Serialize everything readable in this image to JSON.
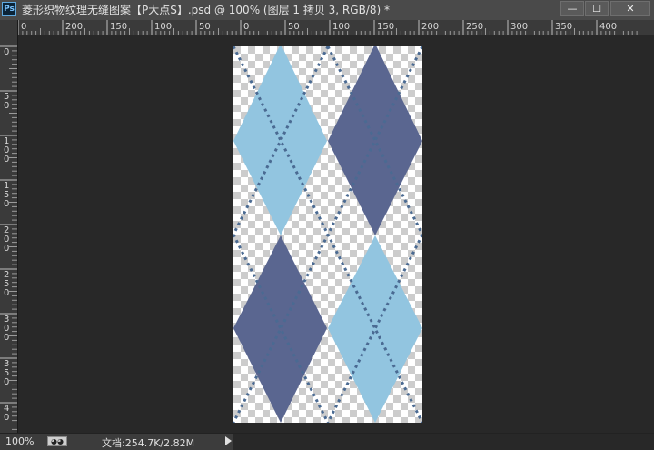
{
  "app": {
    "logo": "Ps"
  },
  "window": {
    "title": "菱形织物纹理无缝图案【P大点S】.psd @ 100% (图层 1 拷贝 3, RGB/8) *",
    "controls": {
      "minimize": "—",
      "maximize": "☐",
      "close": "✕"
    }
  },
  "ruler": {
    "h_labels": [
      "0",
      "200",
      "150",
      "100",
      "50",
      "0",
      "50",
      "100",
      "150",
      "200",
      "250",
      "300",
      "350",
      "400"
    ],
    "v_labels": [
      "0",
      "50",
      "100",
      "150",
      "200",
      "250",
      "300",
      "350",
      "40"
    ]
  },
  "canvas": {
    "pattern": "argyle",
    "colors": {
      "light_diamond": "#92c5e0",
      "dark_diamond": "#5a6690",
      "stitch": "#4a6a92",
      "checker_light": "#ffffff",
      "checker_dark": "#cccccc",
      "workspace": "#282828"
    }
  },
  "status": {
    "zoom": "100%",
    "doc_info": "文档:254.7K/2.82M",
    "icon": "status-icon"
  }
}
